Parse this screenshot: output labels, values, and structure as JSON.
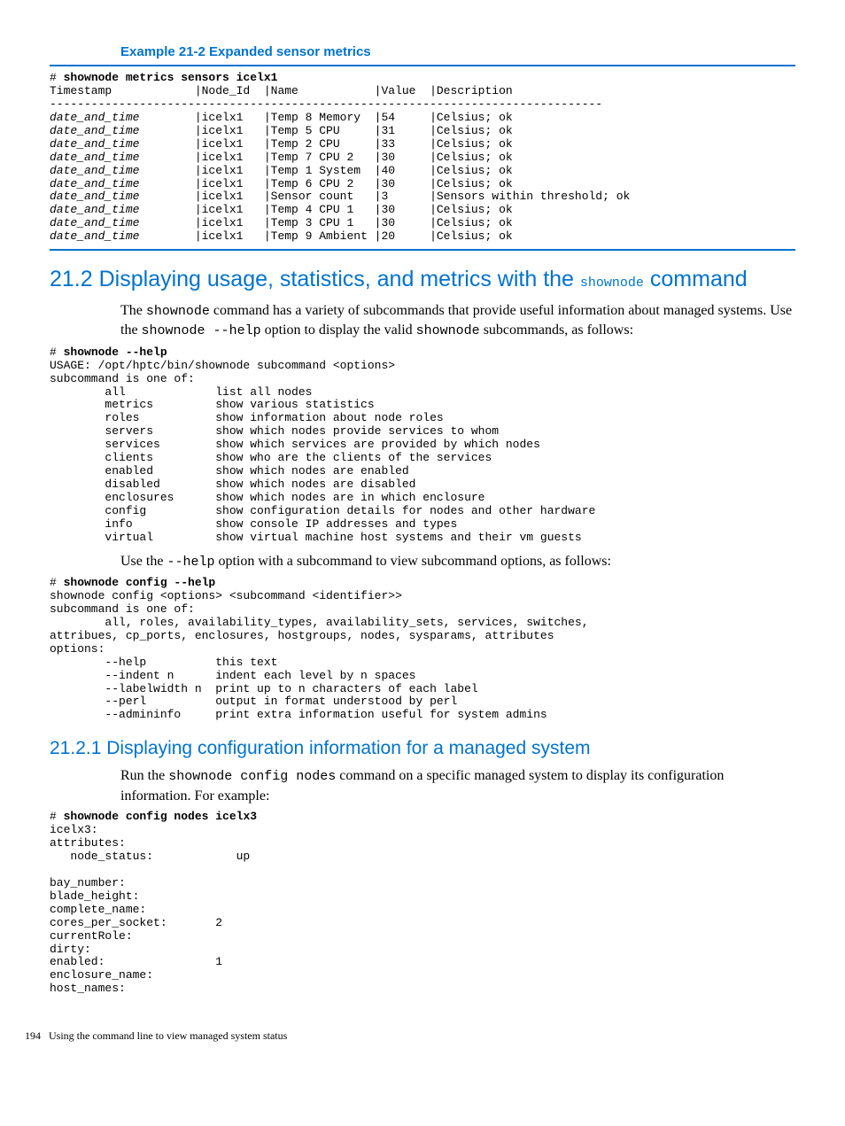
{
  "example": {
    "title": "Example 21-2 Expanded sensor metrics",
    "cmd_prefix": "# ",
    "cmd": "shownode metrics sensors icelx1",
    "header": "Timestamp            |Node_Id  |Name           |Value  |Description",
    "rule": "--------------------------------------------------------------------------------",
    "rows": [
      [
        "date_and_time",
        "icelx1",
        "Temp 8 Memory",
        "54",
        "Celsius; ok"
      ],
      [
        "date_and_time",
        "icelx1",
        "Temp 5 CPU",
        "31",
        "Celsius; ok"
      ],
      [
        "date_and_time",
        "icelx1",
        "Temp 2 CPU",
        "33",
        "Celsius; ok"
      ],
      [
        "date_and_time",
        "icelx1",
        "Temp 7 CPU 2",
        "30",
        "Celsius; ok"
      ],
      [
        "date_and_time",
        "icelx1",
        "Temp 1 System",
        "40",
        "Celsius; ok"
      ],
      [
        "date_and_time",
        "icelx1",
        "Temp 6 CPU 2",
        "30",
        "Celsius; ok"
      ],
      [
        "date_and_time",
        "icelx1",
        "Sensor count",
        "3",
        "Sensors within threshold; ok"
      ],
      [
        "date_and_time",
        "icelx1",
        "Temp 4 CPU 1",
        "30",
        "Celsius; ok"
      ],
      [
        "date_and_time",
        "icelx1",
        "Temp 3 CPU 1",
        "30",
        "Celsius; ok"
      ],
      [
        "date_and_time",
        "icelx1",
        "Temp 9 Ambient",
        "20",
        "Celsius; ok"
      ]
    ]
  },
  "section": {
    "num": "21.2",
    "title_a": "Displaying usage, statistics, and metrics with the ",
    "title_code": "shownode",
    "title_b": " command",
    "para1_a": "The ",
    "para1_code1": "shownode",
    "para1_b": " command has a variety of subcommands that provide useful information about managed systems. Use the ",
    "para1_code2": "shownode --help",
    "para1_c": " option to display the valid ",
    "para1_code3": "shownode",
    "para1_d": " subcommands, as follows:",
    "help_cmd_prefix": "# ",
    "help_cmd": "shownode --help",
    "help_body": "USAGE: /opt/hptc/bin/shownode subcommand <options>\nsubcommand is one of:\n        all             list all nodes\n        metrics         show various statistics\n        roles           show information about node roles\n        servers         show which nodes provide services to whom\n        services        show which services are provided by which nodes\n        clients         show who are the clients of the services\n        enabled         show which nodes are enabled\n        disabled        show which nodes are disabled\n        enclosures      show which nodes are in which enclosure\n        config          show configuration details for nodes and other hardware\n        info            show console IP addresses and types\n        virtual         show virtual machine host systems and their vm guests",
    "para2_a": "Use the ",
    "para2_code": "--help",
    "para2_b": " option with a subcommand to view subcommand options, as follows:",
    "cfg_cmd_prefix": "# ",
    "cfg_cmd": "shownode config --help",
    "cfg_body": "shownode config <options> <subcommand <identifier>>\nsubcommand is one of:\n        all, roles, availability_types, availability_sets, services, switches,\nattribues, cp_ports, enclosures, hostgroups, nodes, sysparams, attributes\noptions:\n        --help          this text\n        --indent n      indent each level by n spaces\n        --labelwidth n  print up to n characters of each label\n        --perl          output in format understood by perl\n        --admininfo     print extra information useful for system admins"
  },
  "subsection": {
    "num": "21.2.1",
    "title": "Displaying configuration information for a managed system",
    "para_a": "Run the ",
    "para_code": "shownode config nodes",
    "para_b": " command on a specific managed system to display its configuration information. For example:",
    "cmd_prefix": "# ",
    "cmd": "shownode config nodes icelx3",
    "body": "icelx3:\nattributes:\n   node_status:            up\n\nbay_number:\nblade_height:\ncomplete_name:\ncores_per_socket:       2\ncurrentRole:\ndirty:\nenabled:                1\nenclosure_name:\nhost_names:"
  },
  "footer": {
    "page": "194",
    "text": "Using the command line to view managed system status"
  }
}
